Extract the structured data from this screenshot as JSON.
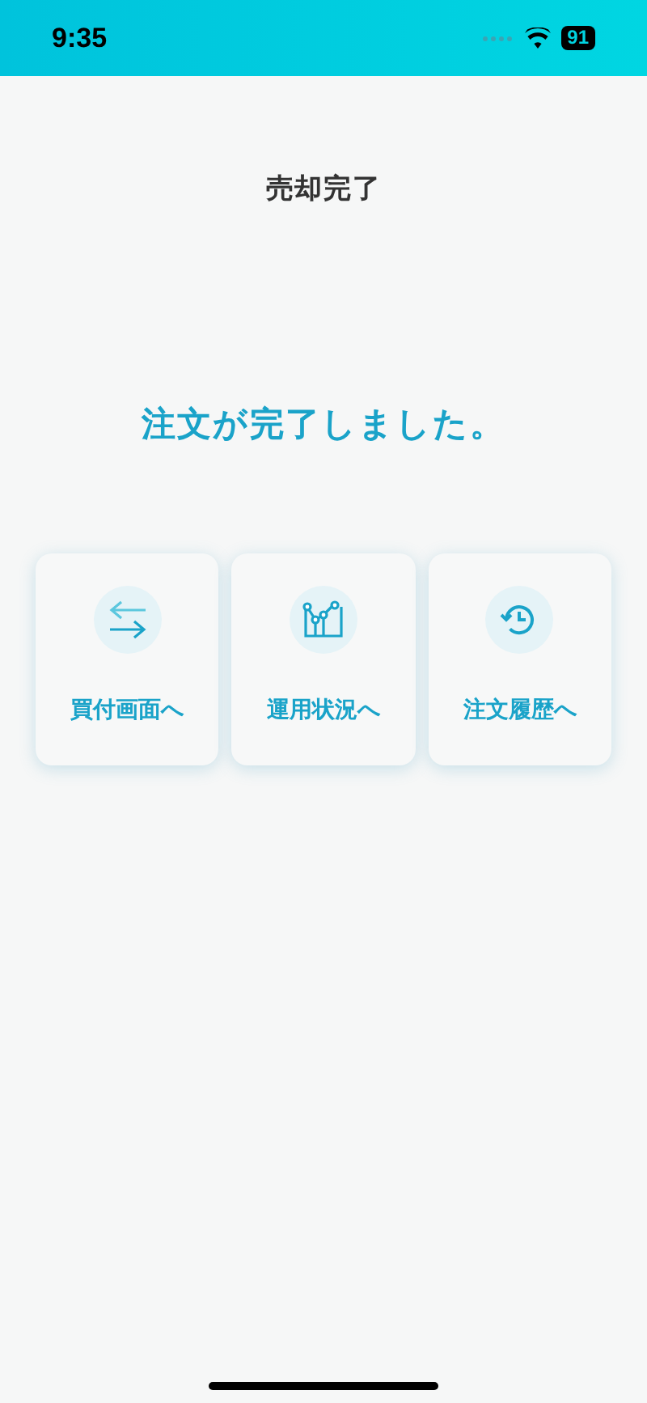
{
  "status_bar": {
    "time": "9:35",
    "battery": "91"
  },
  "title": "売却完了",
  "message": "注文が完了しました。",
  "actions": [
    {
      "kind": "exchange",
      "label": "買付画面へ"
    },
    {
      "kind": "chart",
      "label": "運用状況へ"
    },
    {
      "kind": "history",
      "label": "注文履歴へ"
    }
  ]
}
